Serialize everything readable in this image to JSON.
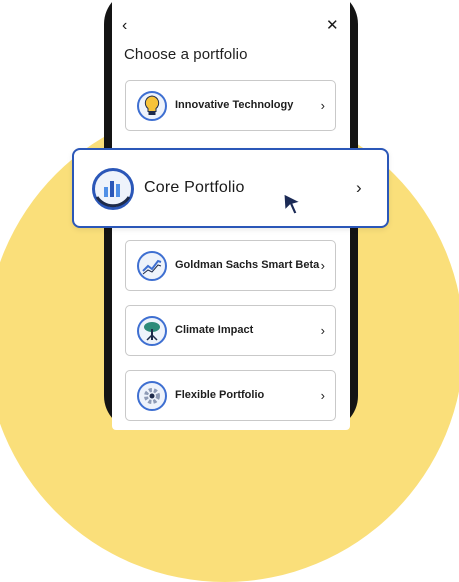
{
  "header": {
    "back_icon": "‹",
    "close_icon": "✕",
    "title": "Choose a portfolio"
  },
  "portfolios": [
    {
      "label": "Innovative Technology",
      "icon": "lightbulb-icon"
    },
    {
      "label": "Core Portfolio",
      "icon": "bar-chart-icon",
      "highlighted": true
    },
    {
      "label": "Goldman Sachs Smart Beta",
      "icon": "trend-line-icon"
    },
    {
      "label": "Climate Impact",
      "icon": "tree-icon"
    },
    {
      "label": "Flexible Portfolio",
      "icon": "gear-icon"
    }
  ],
  "chevron": "›",
  "colors": {
    "background_circle": "#fadf7a",
    "accent_blue": "#2b57b8",
    "phone_frame": "#141414"
  }
}
